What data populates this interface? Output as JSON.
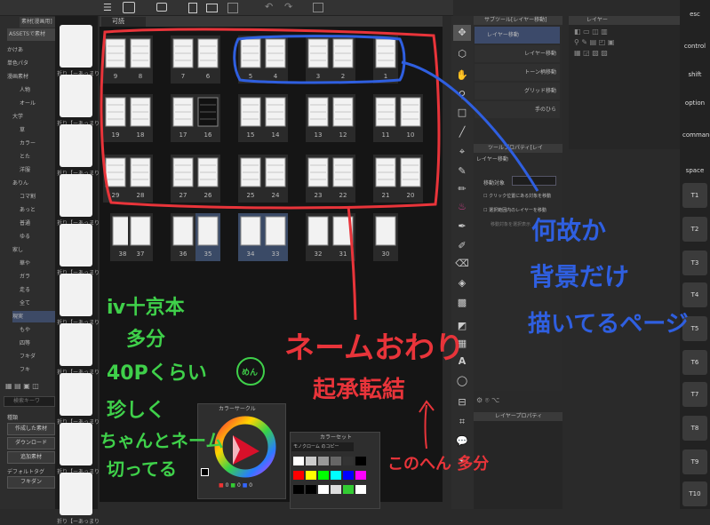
{
  "left_panel": {
    "asset_tab": "ASSETSで素材",
    "tab_material": "素材[漫画用]",
    "tree": [
      "かけあ",
      "単色パタ",
      "漫画素材",
      "人物",
      "オール",
      "大学",
      "草",
      "カラー",
      "とた",
      "洋服",
      "ありん",
      "コマ割",
      "あっと",
      "普通",
      "ゆる",
      "家し",
      "華や",
      "ガラ",
      "走る",
      "全て",
      "現実",
      "もや",
      "四等",
      "フキダ",
      "フキ"
    ],
    "search_placeholder": "検索キーワ",
    "kind_label": "種類",
    "buttons": [
      "作成した素材",
      "ダウンロード",
      "追加素材"
    ],
    "default_tag_label": "デフォルトタグ",
    "tag": "フキダン",
    "thumb_labels": [
      "折り【ーあっまり",
      "折り【ーあっまり",
      "折り【ーあっまり",
      "折り【ーあっまり",
      "折り【ーあっまり",
      "折り【ーあっまり",
      "折り【ーあっまり",
      "折り【ーあっまり",
      "折り【ーあっまり",
      "折り【ーあっまり"
    ]
  },
  "page_manager": {
    "tab": "可読",
    "pages": [
      [
        "9",
        "8",
        "7",
        "6",
        "5",
        "4",
        "3",
        "2",
        "1"
      ],
      [
        "19",
        "18",
        "17",
        "16",
        "15",
        "14",
        "13",
        "12",
        "11",
        "10"
      ],
      [
        "29",
        "28",
        "27",
        "26",
        "25",
        "24",
        "23",
        "22",
        "21",
        "20"
      ],
      [
        "38",
        "37",
        "36",
        "35",
        "34",
        "33",
        "32",
        "31",
        "30"
      ]
    ]
  },
  "right_panel": {
    "subtool_tab": "サブツール[レイヤー移動]",
    "layer_tab": "レイヤー",
    "subtools": [
      "レイヤー移動",
      "レイヤー移動",
      "トーン柄移動",
      "グリッド移動",
      "手のひら"
    ],
    "tool_prop_tab": "ツールプロパティ[レイ",
    "tool_prop_title": "レイヤー移動",
    "move_target_label": "移動対象",
    "options": [
      "クリック位置にある対象を移動",
      "選択範囲内のレイヤーを移動",
      "移動対象を選択表示"
    ],
    "layer_prop_tab": "レイヤープロパティ"
  },
  "color_circle": {
    "title": "カラーサークル",
    "values": [
      "0",
      "0",
      "0"
    ]
  },
  "color_set": {
    "title": "カラーセット",
    "name": "モノクローム のコピー"
  },
  "side_keys": [
    "esc",
    "control",
    "shift",
    "option",
    "command",
    "space",
    "T1",
    "T2",
    "T3",
    "T4",
    "T5",
    "T6",
    "T7",
    "T8",
    "T9",
    "T10"
  ],
  "annotations": {
    "green": [
      "ⅳ十京本",
      "多分",
      "40Pくらい",
      "珍しく",
      "ちゃんとネーム",
      "切ってる"
    ],
    "green_face": "めん",
    "red_main": "ネームおわり",
    "red_sub": "起承転結",
    "red_note": "このへん 多分",
    "blue": [
      "何故か",
      "背景だけ",
      "描いてるページ"
    ]
  },
  "colors": {
    "red": "#e8343a",
    "blue": "#2f5fe0",
    "green": "#3fd04a"
  }
}
